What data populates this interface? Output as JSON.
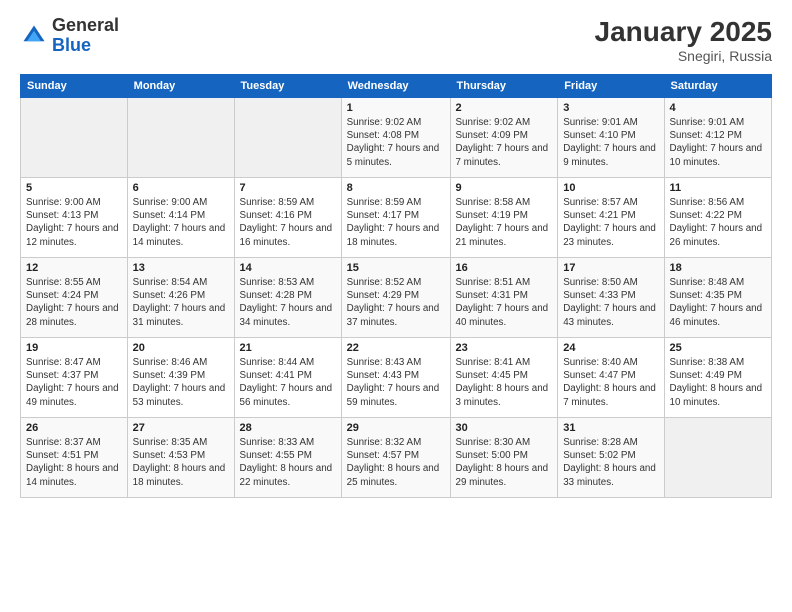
{
  "header": {
    "logo_line1": "General",
    "logo_line2": "Blue",
    "month_title": "January 2025",
    "subtitle": "Snegiri, Russia"
  },
  "days_of_week": [
    "Sunday",
    "Monday",
    "Tuesday",
    "Wednesday",
    "Thursday",
    "Friday",
    "Saturday"
  ],
  "weeks": [
    [
      {
        "day": "",
        "info": ""
      },
      {
        "day": "",
        "info": ""
      },
      {
        "day": "",
        "info": ""
      },
      {
        "day": "1",
        "info": "Sunrise: 9:02 AM\nSunset: 4:08 PM\nDaylight: 7 hours\nand 5 minutes."
      },
      {
        "day": "2",
        "info": "Sunrise: 9:02 AM\nSunset: 4:09 PM\nDaylight: 7 hours\nand 7 minutes."
      },
      {
        "day": "3",
        "info": "Sunrise: 9:01 AM\nSunset: 4:10 PM\nDaylight: 7 hours\nand 9 minutes."
      },
      {
        "day": "4",
        "info": "Sunrise: 9:01 AM\nSunset: 4:12 PM\nDaylight: 7 hours\nand 10 minutes."
      }
    ],
    [
      {
        "day": "5",
        "info": "Sunrise: 9:00 AM\nSunset: 4:13 PM\nDaylight: 7 hours\nand 12 minutes."
      },
      {
        "day": "6",
        "info": "Sunrise: 9:00 AM\nSunset: 4:14 PM\nDaylight: 7 hours\nand 14 minutes."
      },
      {
        "day": "7",
        "info": "Sunrise: 8:59 AM\nSunset: 4:16 PM\nDaylight: 7 hours\nand 16 minutes."
      },
      {
        "day": "8",
        "info": "Sunrise: 8:59 AM\nSunset: 4:17 PM\nDaylight: 7 hours\nand 18 minutes."
      },
      {
        "day": "9",
        "info": "Sunrise: 8:58 AM\nSunset: 4:19 PM\nDaylight: 7 hours\nand 21 minutes."
      },
      {
        "day": "10",
        "info": "Sunrise: 8:57 AM\nSunset: 4:21 PM\nDaylight: 7 hours\nand 23 minutes."
      },
      {
        "day": "11",
        "info": "Sunrise: 8:56 AM\nSunset: 4:22 PM\nDaylight: 7 hours\nand 26 minutes."
      }
    ],
    [
      {
        "day": "12",
        "info": "Sunrise: 8:55 AM\nSunset: 4:24 PM\nDaylight: 7 hours\nand 28 minutes."
      },
      {
        "day": "13",
        "info": "Sunrise: 8:54 AM\nSunset: 4:26 PM\nDaylight: 7 hours\nand 31 minutes."
      },
      {
        "day": "14",
        "info": "Sunrise: 8:53 AM\nSunset: 4:28 PM\nDaylight: 7 hours\nand 34 minutes."
      },
      {
        "day": "15",
        "info": "Sunrise: 8:52 AM\nSunset: 4:29 PM\nDaylight: 7 hours\nand 37 minutes."
      },
      {
        "day": "16",
        "info": "Sunrise: 8:51 AM\nSunset: 4:31 PM\nDaylight: 7 hours\nand 40 minutes."
      },
      {
        "day": "17",
        "info": "Sunrise: 8:50 AM\nSunset: 4:33 PM\nDaylight: 7 hours\nand 43 minutes."
      },
      {
        "day": "18",
        "info": "Sunrise: 8:48 AM\nSunset: 4:35 PM\nDaylight: 7 hours\nand 46 minutes."
      }
    ],
    [
      {
        "day": "19",
        "info": "Sunrise: 8:47 AM\nSunset: 4:37 PM\nDaylight: 7 hours\nand 49 minutes."
      },
      {
        "day": "20",
        "info": "Sunrise: 8:46 AM\nSunset: 4:39 PM\nDaylight: 7 hours\nand 53 minutes."
      },
      {
        "day": "21",
        "info": "Sunrise: 8:44 AM\nSunset: 4:41 PM\nDaylight: 7 hours\nand 56 minutes."
      },
      {
        "day": "22",
        "info": "Sunrise: 8:43 AM\nSunset: 4:43 PM\nDaylight: 7 hours\nand 59 minutes."
      },
      {
        "day": "23",
        "info": "Sunrise: 8:41 AM\nSunset: 4:45 PM\nDaylight: 8 hours\nand 3 minutes."
      },
      {
        "day": "24",
        "info": "Sunrise: 8:40 AM\nSunset: 4:47 PM\nDaylight: 8 hours\nand 7 minutes."
      },
      {
        "day": "25",
        "info": "Sunrise: 8:38 AM\nSunset: 4:49 PM\nDaylight: 8 hours\nand 10 minutes."
      }
    ],
    [
      {
        "day": "26",
        "info": "Sunrise: 8:37 AM\nSunset: 4:51 PM\nDaylight: 8 hours\nand 14 minutes."
      },
      {
        "day": "27",
        "info": "Sunrise: 8:35 AM\nSunset: 4:53 PM\nDaylight: 8 hours\nand 18 minutes."
      },
      {
        "day": "28",
        "info": "Sunrise: 8:33 AM\nSunset: 4:55 PM\nDaylight: 8 hours\nand 22 minutes."
      },
      {
        "day": "29",
        "info": "Sunrise: 8:32 AM\nSunset: 4:57 PM\nDaylight: 8 hours\nand 25 minutes."
      },
      {
        "day": "30",
        "info": "Sunrise: 8:30 AM\nSunset: 5:00 PM\nDaylight: 8 hours\nand 29 minutes."
      },
      {
        "day": "31",
        "info": "Sunrise: 8:28 AM\nSunset: 5:02 PM\nDaylight: 8 hours\nand 33 minutes."
      },
      {
        "day": "",
        "info": ""
      }
    ]
  ]
}
